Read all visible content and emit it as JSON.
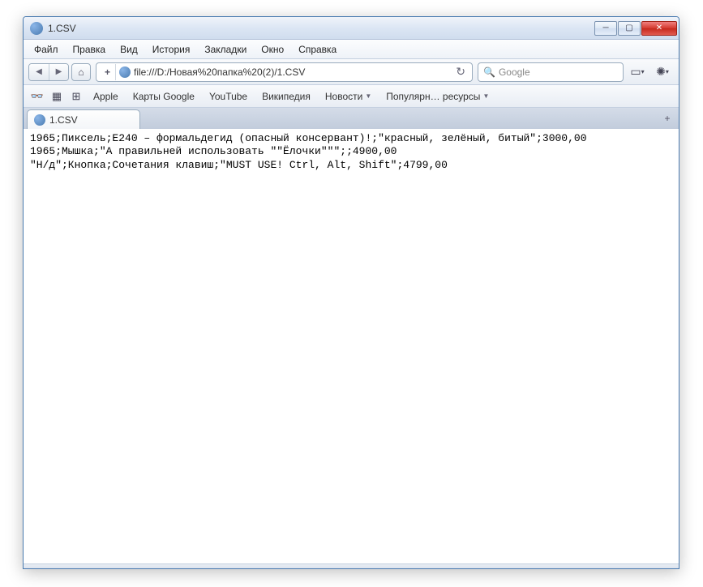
{
  "window": {
    "title": "1.CSV"
  },
  "menu": {
    "file": "Файл",
    "edit": "Правка",
    "view": "Вид",
    "history": "История",
    "bookmarks": "Закладки",
    "window": "Окно",
    "help": "Справка"
  },
  "address": {
    "url": "file:///D:/Новая%20папка%20(2)/1.CSV"
  },
  "search": {
    "placeholder": "Google"
  },
  "bookmarks": {
    "apple": "Apple",
    "gmaps": "Карты Google",
    "youtube": "YouTube",
    "wikipedia": "Википедия",
    "news": "Новости",
    "popular": "Популярн… ресурсы"
  },
  "tab": {
    "title": "1.CSV"
  },
  "content": {
    "line1": "1965;Пиксель;Е240 – формальдегид (опасный консервант)!;\"красный, зелёный, битый\";3000,00",
    "line2": "1965;Мышка;\"А правильней использовать \"\"Ёлочки\"\"\";;4900,00",
    "line3": "\"Н/д\";Кнопка;Сочетания клавиш;\"MUST USE! Ctrl, Alt, Shift\";4799,00"
  }
}
